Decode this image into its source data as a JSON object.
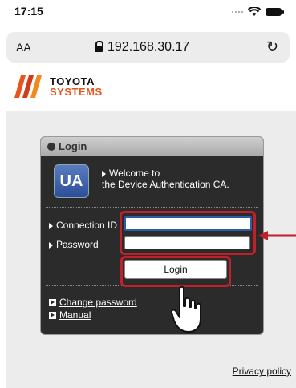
{
  "status": {
    "time": "17:15"
  },
  "browser": {
    "aa_label": "AA",
    "url": "192.168.30.17",
    "reload_symbol": "↻"
  },
  "logo": {
    "line1": "TOYOTA",
    "line2": "SYSTEMS"
  },
  "login_panel": {
    "title": "Login",
    "badge": "UA",
    "welcome_line1": "Welcome to",
    "welcome_line2": "the Device Authentication CA.",
    "connection_label": "Connection ID",
    "password_label": "Password",
    "connection_value": "",
    "password_value": "",
    "login_button": "Login",
    "links": [
      {
        "label": "Change password"
      },
      {
        "label": "Manual"
      }
    ]
  },
  "footer": {
    "privacy": "Privacy policy"
  },
  "colors": {
    "highlight": "#c0202a",
    "panel": "#2b2b2b",
    "accent_orange": "#e8541b"
  }
}
